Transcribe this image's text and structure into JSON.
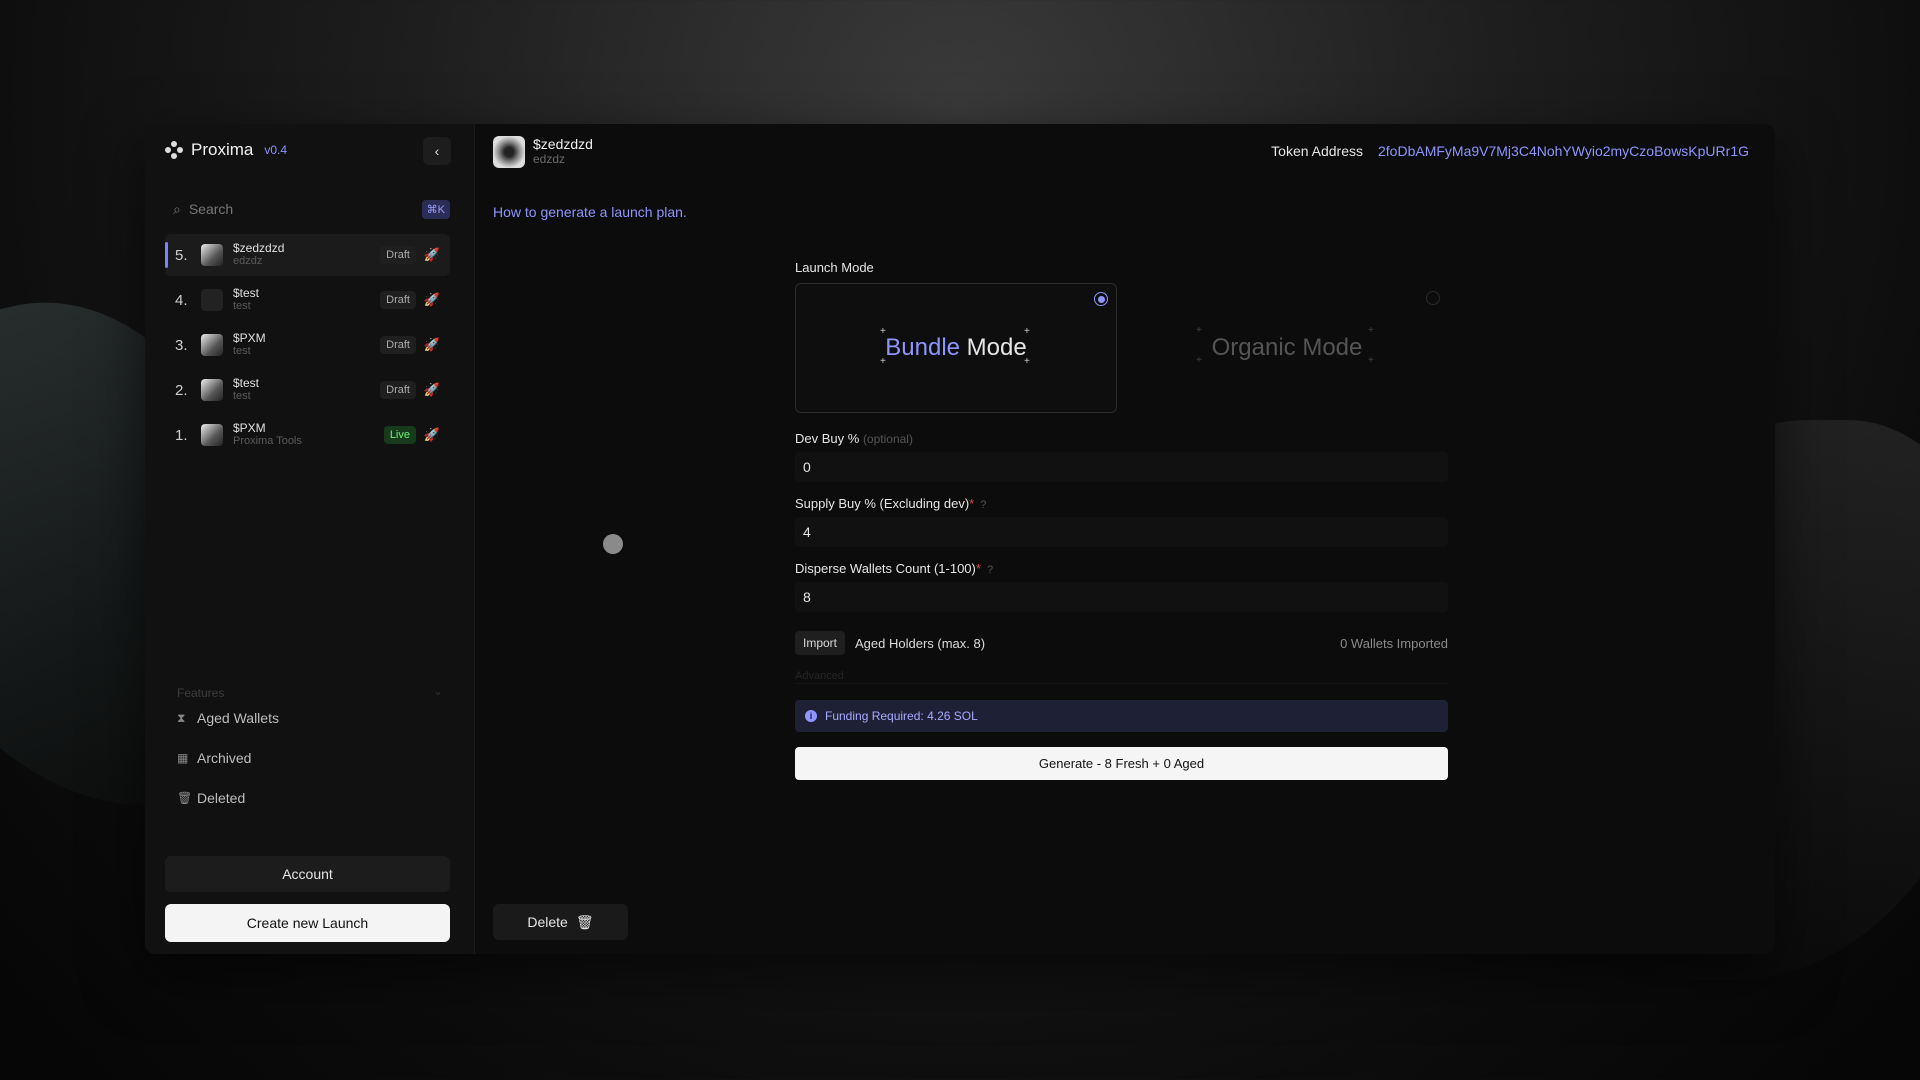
{
  "app": {
    "name": "Proxima",
    "version": "v0.4"
  },
  "search": {
    "placeholder": "Search",
    "shortcut": "⌘K"
  },
  "launches": [
    {
      "index": "5.",
      "name": "$zedzdzd",
      "sub": "edzdz",
      "status": "Draft",
      "active": true
    },
    {
      "index": "4.",
      "name": "$test",
      "sub": "test",
      "status": "Draft"
    },
    {
      "index": "3.",
      "name": "$PXM",
      "sub": "test",
      "status": "Draft"
    },
    {
      "index": "2.",
      "name": "$test",
      "sub": "test",
      "status": "Draft"
    },
    {
      "index": "1.",
      "name": "$PXM",
      "sub": "Proxima Tools",
      "status": "Live"
    }
  ],
  "features": {
    "label": "Features",
    "items": [
      {
        "label": "Aged Wallets",
        "icon": "hourglass-icon"
      },
      {
        "label": "Archived",
        "icon": "archive-icon"
      },
      {
        "label": "Deleted",
        "icon": "trash-icon"
      }
    ]
  },
  "sidebar_buttons": {
    "account": "Account",
    "create": "Create new Launch"
  },
  "token": {
    "name": "$zedzdzd",
    "sub": "edzdz",
    "address_label": "Token Address",
    "address": "2foDbAMFyMa9V7Mj3C4NohYWyio2myCzoBowsKpURr1G"
  },
  "help_link": "How to generate a launch plan.",
  "form": {
    "launch_mode_label": "Launch Mode",
    "bundle_accent": "Bundle",
    "bundle_rest": "Mode",
    "organic_label": "Organic Mode",
    "selected_mode": "bundle",
    "dev_buy_label": "Dev Buy %",
    "dev_buy_optional": "(optional)",
    "dev_buy_value": "0",
    "supply_buy_label": "Supply Buy % (Excluding dev)",
    "supply_buy_value": "4",
    "disperse_label": "Disperse Wallets Count (1-100)",
    "disperse_value": "8",
    "import_label": "Import",
    "aged_label": "Aged Holders (max. 8)",
    "aged_count": "0 Wallets Imported",
    "advanced_label": "Advanced",
    "funding": "Funding Required: 4.26 SOL",
    "generate": "Generate - 8 Fresh + 0 Aged"
  },
  "delete_label": "Delete",
  "colors": {
    "accent": "#8f95ff",
    "live": "#6ef07c"
  }
}
